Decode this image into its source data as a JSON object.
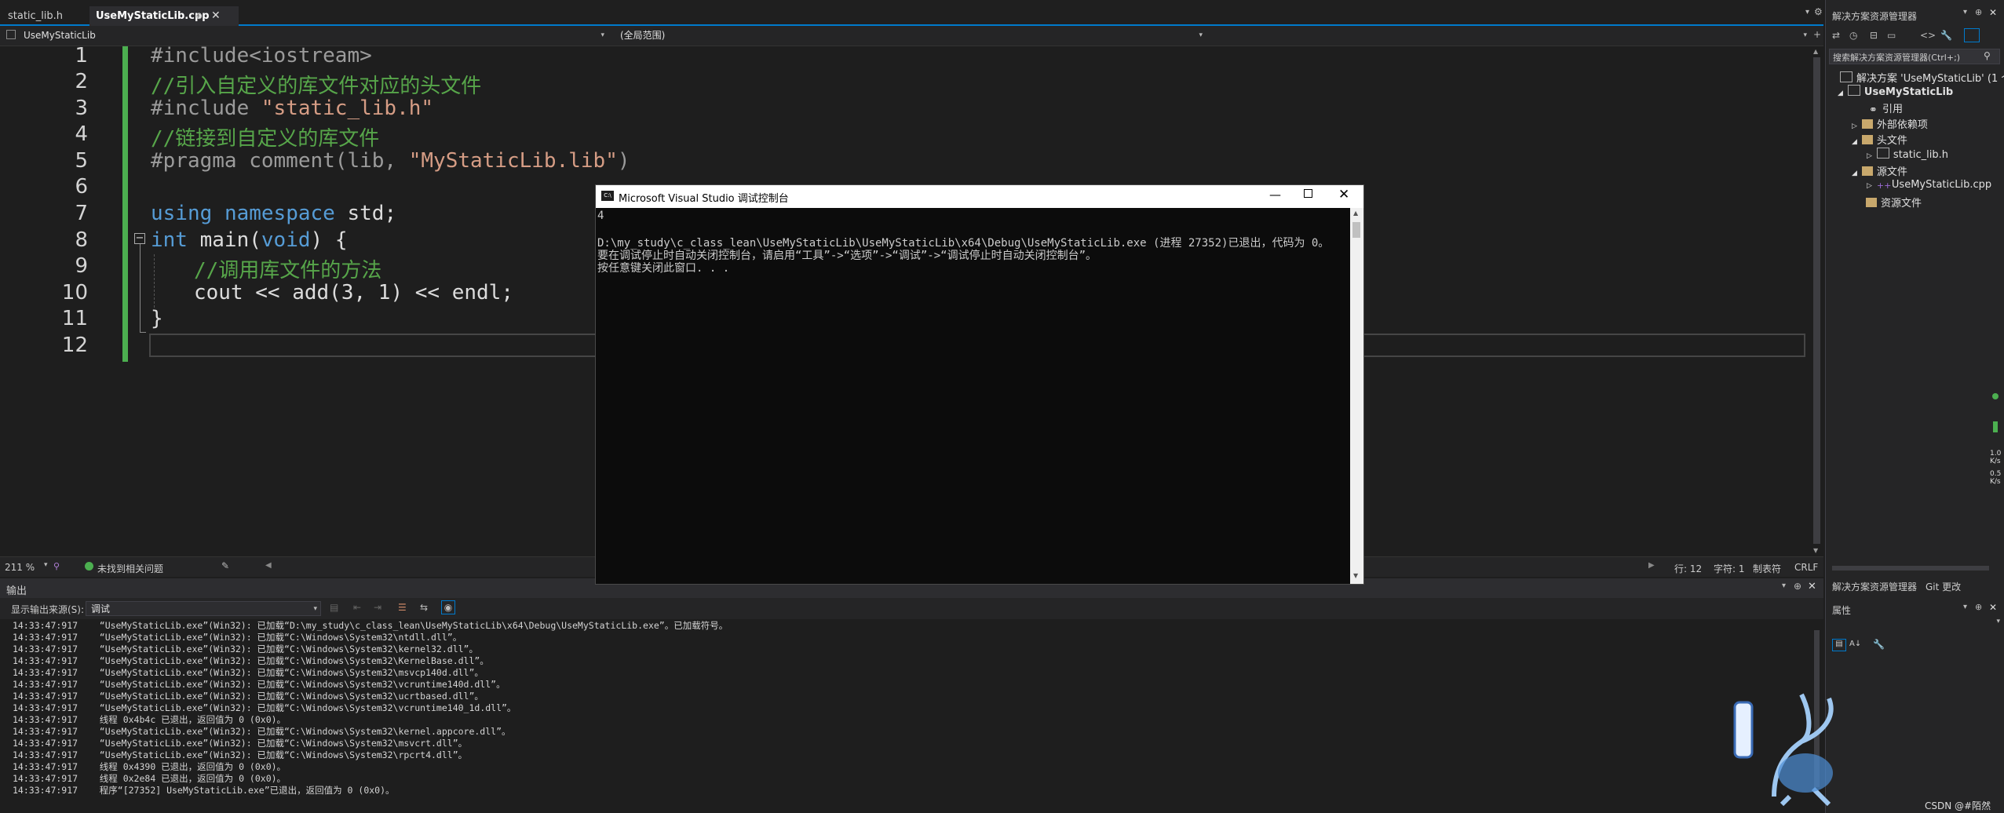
{
  "tabs": [
    {
      "label": "static_lib.h",
      "active": false
    },
    {
      "label": "UseMyStaticLib.cpp",
      "active": true
    }
  ],
  "tab_pin_icon": "⊕",
  "nav": {
    "project": "UseMyStaticLib",
    "scope": "(全局范围)",
    "member": ""
  },
  "editor": {
    "line_numbers": [
      "1",
      "2",
      "3",
      "4",
      "5",
      "6",
      "7",
      "8",
      "9",
      "10",
      "11",
      "12"
    ],
    "lines": {
      "l1": "#include<iostream>",
      "l2": "//引入自定义的库文件对应的头文件",
      "l3a": "#include ",
      "l3b": "\"static_lib.h\"",
      "l4": "//链接到自定义的库文件",
      "l5a": "#pragma comment(lib, ",
      "l5b": "\"MyStaticLib.lib\"",
      "l5c": ")",
      "l7a": "using",
      "l7b": "namespace",
      "l7c": " std;",
      "l8a": "int",
      "l8b": " main(",
      "l8c": "void",
      "l8d": ") {",
      "l9": "//调用库文件的方法",
      "l10": "cout << add(3, 1) << endl;",
      "l11": "}"
    }
  },
  "console": {
    "title": "Microsoft Visual Studio 调试控制台",
    "icon": "C:\\",
    "lines": [
      "4",
      "",
      "D:\\my_study\\c_class_lean\\UseMyStaticLib\\UseMyStaticLib\\x64\\Debug\\UseMyStaticLib.exe (进程 27352)已退出，代码为 0。",
      "要在调试停止时自动关闭控制台，请启用“工具”->“选项”->“调试”->“调试停止时自动关闭控制台”。",
      "按任意键关闭此窗口. . ."
    ]
  },
  "status": {
    "zoom": "211 %",
    "issues": "未找到相关问题",
    "line": "行: 12",
    "char": "字符: 1",
    "tabs": "制表符",
    "eol": "CRLF"
  },
  "output": {
    "title": "输出",
    "source_label": "显示输出来源(S):",
    "source_value": "调试",
    "lines": [
      "14:33:47:917    “UseMyStaticLib.exe”(Win32): 已加载“D:\\my_study\\c_class_lean\\UseMyStaticLib\\x64\\Debug\\UseMyStaticLib.exe”。已加载符号。",
      "14:33:47:917    “UseMyStaticLib.exe”(Win32): 已加载“C:\\Windows\\System32\\ntdll.dll”。",
      "14:33:47:917    “UseMyStaticLib.exe”(Win32): 已加载“C:\\Windows\\System32\\kernel32.dll”。",
      "14:33:47:917    “UseMyStaticLib.exe”(Win32): 已加载“C:\\Windows\\System32\\KernelBase.dll”。",
      "14:33:47:917    “UseMyStaticLib.exe”(Win32): 已加载“C:\\Windows\\System32\\msvcp140d.dll”。",
      "14:33:47:917    “UseMyStaticLib.exe”(Win32): 已加载“C:\\Windows\\System32\\vcruntime140d.dll”。",
      "14:33:47:917    “UseMyStaticLib.exe”(Win32): 已加载“C:\\Windows\\System32\\ucrtbased.dll”。",
      "14:33:47:917    “UseMyStaticLib.exe”(Win32): 已加载“C:\\Windows\\System32\\vcruntime140_1d.dll”。",
      "14:33:47:917    线程 0x4b4c 已退出，返回值为 0 (0x0)。",
      "14:33:47:917    “UseMyStaticLib.exe”(Win32): 已加载“C:\\Windows\\System32\\kernel.appcore.dll”。",
      "14:33:47:917    “UseMyStaticLib.exe”(Win32): 已加载“C:\\Windows\\System32\\msvcrt.dll”。",
      "14:33:47:917    “UseMyStaticLib.exe”(Win32): 已加载“C:\\Windows\\System32\\rpcrt4.dll”。",
      "14:33:47:917    线程 0x4390 已退出，返回值为 0 (0x0)。",
      "14:33:47:917    线程 0x2e84 已退出，返回值为 0 (0x0)。",
      "14:33:47:917    程序“[27352] UseMyStaticLib.exe”已退出，返回值为 0 (0x0)。"
    ]
  },
  "solution_explorer": {
    "title": "解决方案资源管理器",
    "search_placeholder": "搜索解决方案资源管理器(Ctrl+;)",
    "nodes": [
      {
        "label": "解决方案 'UseMyStaticLib' (1 个项"
      },
      {
        "label": "UseMyStaticLib"
      },
      {
        "label": "引用"
      },
      {
        "label": "外部依赖项"
      },
      {
        "label": "头文件"
      },
      {
        "label": "static_lib.h"
      },
      {
        "label": "源文件"
      },
      {
        "label": "UseMyStaticLib.cpp"
      },
      {
        "label": "资源文件"
      }
    ],
    "bottom_tabs": [
      "解决方案资源管理器",
      "Git 更改"
    ]
  },
  "properties": {
    "title": "属性"
  },
  "network": {
    "up": "1.0",
    "down": "0.5",
    "unit": "K/s"
  },
  "watermark": "CSDN @#陌然",
  "colors": {
    "accent": "#007acc",
    "editor_bg": "#1e1e1e",
    "keyword": "#569cd6",
    "comment": "#57a64a",
    "string": "#d69d85",
    "change_bar": "#4caf50"
  }
}
